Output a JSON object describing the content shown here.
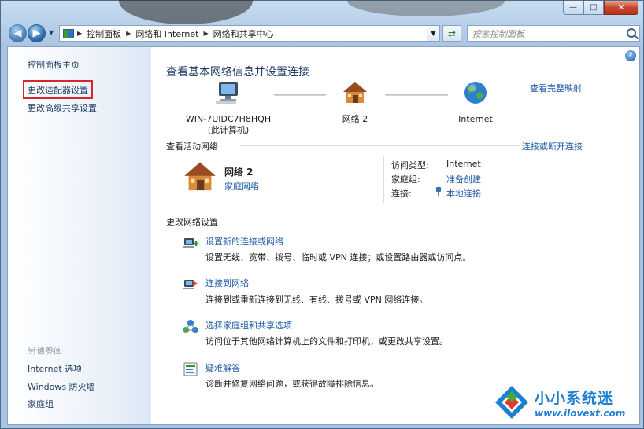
{
  "window": {
    "caption": {
      "minimize": "—",
      "maximize": "□",
      "close": "✕"
    }
  },
  "navbar": {
    "breadcrumb": [
      "控制面板",
      "网络和 Internet",
      "网络和共享中心"
    ],
    "search_placeholder": "搜索控制面板"
  },
  "sidebar": {
    "home": "控制面板主页",
    "links": [
      "更改适配器设置",
      "更改高级共享设置"
    ],
    "see_also_heading": "另请参阅",
    "see_also": [
      "Internet 选项",
      "Windows 防火墙",
      "家庭组"
    ]
  },
  "main": {
    "title": "查看基本网络信息并设置连接",
    "view_full_map": "查看完整映射",
    "map": {
      "computer": {
        "name": "WIN-7UIDC7H8HQH",
        "sub": "(此计算机)"
      },
      "network": {
        "name": "网络  2"
      },
      "internet": {
        "name": "Internet"
      }
    },
    "active_networks": {
      "heading": "查看活动网络",
      "connect_disconnect": "连接或断开连接",
      "network_name": "网络  2",
      "network_type": "家庭网络",
      "access_type_label": "访问类型:",
      "access_type_value": "Internet",
      "homegroup_label": "家庭组:",
      "homegroup_value": "准备创建",
      "connections_label": "连接:",
      "connections_value": "本地连接"
    },
    "change_settings": {
      "heading": "更改网络设置",
      "tasks": [
        {
          "title": "设置新的连接或网络",
          "desc": "设置无线、宽带、拨号、临时或 VPN 连接；或设置路由器或访问点。"
        },
        {
          "title": "连接到网络",
          "desc": "连接到或重新连接到无线、有线、拨号或 VPN 网络连接。"
        },
        {
          "title": "选择家庭组和共享选项",
          "desc": "访问位于其他网络计算机上的文件和打印机，或更改共享设置。"
        },
        {
          "title": "疑难解答",
          "desc": "诊断并修复网络问题，或获得故障排除信息。"
        }
      ]
    }
  },
  "watermark": {
    "name": "小小系统迷",
    "url": "www.ilovext.com"
  },
  "colors": {
    "link": "#1f5aa8",
    "highlight_box": "#d9262b"
  }
}
